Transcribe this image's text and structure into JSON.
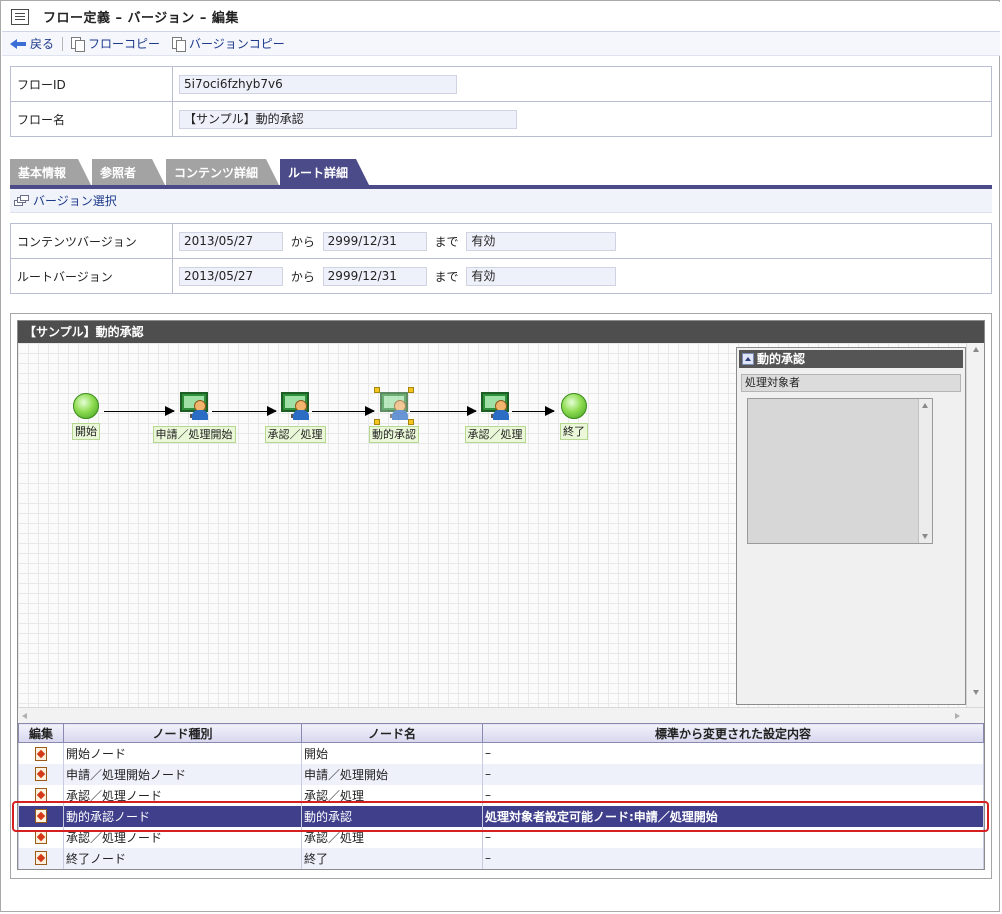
{
  "title": "フロー定義 – バージョン – 編集",
  "toolbar": {
    "back": "戻る",
    "flow_copy": "フローコピー",
    "version_copy": "バージョンコピー"
  },
  "flow": {
    "id_label": "フローID",
    "id_value": "5i7oci6fzhyb7v6",
    "name_label": "フロー名",
    "name_value": "【サンプル】動的承認"
  },
  "tabs": [
    "基本情報",
    "参照者",
    "コンテンツ詳細",
    "ルート詳細"
  ],
  "active_tab": "ルート詳細",
  "version_select": "バージョン選択",
  "versions": {
    "content_label": "コンテンツバージョン",
    "content_from": "2013/05/27",
    "content_to": "2999/12/31",
    "content_status": "有効",
    "route_label": "ルートバージョン",
    "route_from": "2013/05/27",
    "route_to": "2999/12/31",
    "route_status": "有効",
    "from_word": "から",
    "to_word": "まで"
  },
  "designer": {
    "header": "【サンプル】動的承認",
    "nodes": [
      {
        "label": "開始",
        "kind": "start"
      },
      {
        "label": "申請／処理開始",
        "kind": "task"
      },
      {
        "label": "承認／処理",
        "kind": "task"
      },
      {
        "label": "動的承認",
        "kind": "task",
        "selected": true
      },
      {
        "label": "承認／処理",
        "kind": "task"
      },
      {
        "label": "終了",
        "kind": "end"
      }
    ],
    "props": {
      "title": "動的承認",
      "section": "処理対象者"
    }
  },
  "node_table": {
    "headers": [
      "編集",
      "ノード種別",
      "ノード名",
      "標準から変更された設定内容"
    ],
    "rows": [
      {
        "type": "開始ノード",
        "name": "開始",
        "changes": "–"
      },
      {
        "type": "申請／処理開始ノード",
        "name": "申請／処理開始",
        "changes": "–"
      },
      {
        "type": "承認／処理ノード",
        "name": "承認／処理",
        "changes": "–"
      },
      {
        "type": "動的承認ノード",
        "name": "動的承認",
        "changes": "処理対象者設定可能ノード:申請／処理開始"
      },
      {
        "type": "承認／処理ノード",
        "name": "承認／処理",
        "changes": "–"
      },
      {
        "type": "終了ノード",
        "name": "終了",
        "changes": "–"
      }
    ]
  },
  "colors": {
    "accent": "#4b4b8a",
    "selected_row": "#3f3f8c",
    "highlight": "#d42020"
  }
}
